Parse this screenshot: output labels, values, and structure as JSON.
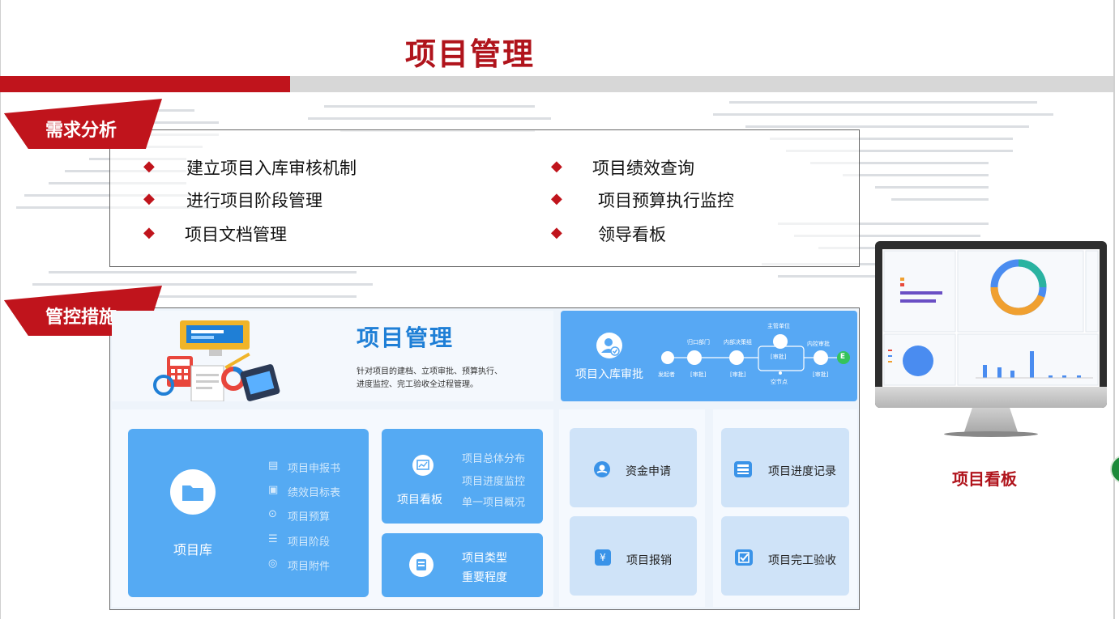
{
  "title": "项目管理",
  "section1": {
    "label": "需求分析",
    "items_left": [
      "建立项目入库审核机制",
      "进行项目阶段管理",
      "项目文档管理"
    ],
    "items_right": [
      "项目绩效查询",
      "项目预算执行监控",
      "领导看板"
    ]
  },
  "section2": {
    "label": "管控措施",
    "header": {
      "title": "项目管理",
      "desc_line1": "针对项目的建档、立项审批、预算执行、",
      "desc_line2": "进度监控、完工验收全过程管理。"
    },
    "approval": {
      "title": "项目入库审批",
      "steps": [
        "发起者",
        "归口部门",
        "内部决策组",
        "主管单位",
        "内控审批"
      ],
      "step_tags": [
        "[审批]",
        "[审批]",
        "[审批]",
        "[审批]"
      ],
      "node_label": "空节点",
      "end_label": "E"
    },
    "library": {
      "label": "项目库",
      "items": [
        "项目申报书",
        "绩效目标表",
        "项目预算",
        "项目阶段",
        "项目附件"
      ]
    },
    "kanban_tile": {
      "label": "项目看板",
      "items": [
        "项目总体分布",
        "项目进度监控",
        "单一项目概况"
      ]
    },
    "type_tile": {
      "line1": "项目类型",
      "line2": "重要程度"
    },
    "fund_apply": "资金申请",
    "progress_record": "项目进度记录",
    "reimburse": "项目报销",
    "completion": "项目完工验收"
  },
  "monitor_label": "项目看板",
  "colors": {
    "brand_red": "#c0141c",
    "tile_blue": "#55aaf3",
    "light_blue": "#cfe3f8"
  }
}
